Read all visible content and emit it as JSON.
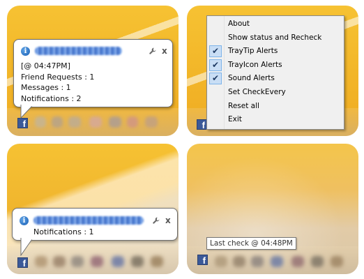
{
  "panel1": {
    "balloon": {
      "lines": [
        "[@ 04:47PM]",
        "Friend Requests : 1",
        "Messages : 1",
        "Notifications : 2"
      ]
    },
    "fb_icon_label": "f"
  },
  "panel2": {
    "menu": [
      {
        "label": "About",
        "checked": false
      },
      {
        "label": "Show status and Recheck",
        "checked": false
      },
      {
        "label": "TrayTip Alerts",
        "checked": true
      },
      {
        "label": "TrayIcon Alerts",
        "checked": true
      },
      {
        "label": "Sound Alerts",
        "checked": true
      },
      {
        "label": "Set CheckEvery",
        "checked": false
      },
      {
        "label": "Reset all",
        "checked": false
      },
      {
        "label": "Exit",
        "checked": false
      }
    ],
    "check_glyph": "✔",
    "fb_icon_label": "f"
  },
  "panel3": {
    "balloon": {
      "lines": [
        "Notifications : 1"
      ]
    },
    "fb_icon_label": "f"
  },
  "panel4": {
    "tooltip": "Last check @ 04:48PM",
    "fb_icon_label": "f"
  },
  "common": {
    "info_glyph": "i",
    "close_glyph": "x"
  },
  "colors": {
    "facebook_blue": "#3b5998",
    "info_blue": "#1a5fb4",
    "menu_check_bg": "#c9def5",
    "wallpaper_yellow": "#f2b528"
  }
}
